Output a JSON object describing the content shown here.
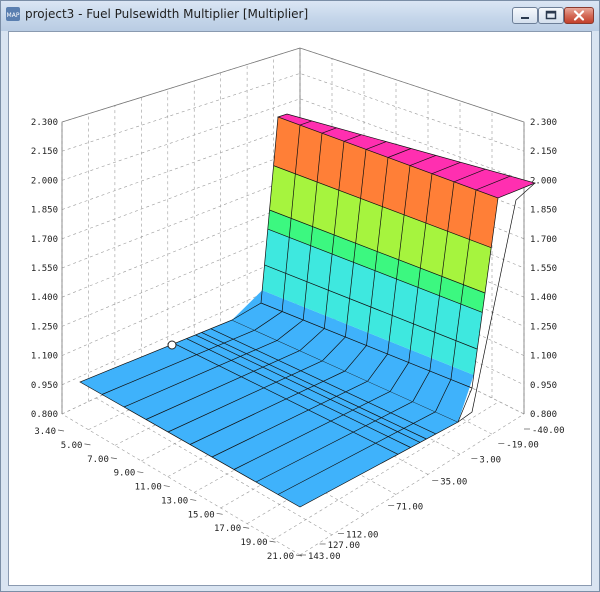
{
  "window": {
    "app_icon_text": "MAP",
    "title": "project3 - Fuel Pulsewidth Multiplier [Multiplier]",
    "buttons": {
      "minimize": "minimize",
      "maximize": "maximize",
      "close": "close"
    }
  },
  "chart_data": {
    "type": "surface3d",
    "title": "Fuel Pulsewidth Multiplier [Multiplier]",
    "z_ticks": [
      "0.800",
      "0.950",
      "1.100",
      "1.250",
      "1.400",
      "1.550",
      "1.700",
      "1.850",
      "2.000",
      "2.150",
      "2.300"
    ],
    "zlim": [
      0.8,
      2.3
    ],
    "x_ticks": [
      "3.40",
      "5.00",
      "7.00",
      "9.00",
      "11.00",
      "13.00",
      "15.00",
      "17.00",
      "19.00",
      "21.00"
    ],
    "y_ticks": [
      "-40.00",
      "-19.00",
      "3.00",
      "35.00",
      "71.00",
      "112.00",
      "127.00",
      "143.00"
    ],
    "y_values": [
      -40,
      -19,
      3,
      35,
      71,
      112,
      127,
      143
    ],
    "row_values": [
      2.0,
      2.0,
      1.03,
      1.0,
      1.0,
      1.0,
      1.0,
      1.0
    ],
    "cursor_label": "cursor-point",
    "colors": {
      "band_blue": "#3fb2fb",
      "band_cyan": "#3ee8df",
      "band_green": "#3cf880",
      "band_lime": "#a6f43e",
      "band_orange": "#ff7f37",
      "band_pink": "#ff2fb0",
      "grid": "#9a9a9a",
      "mesh": "#111111"
    }
  }
}
